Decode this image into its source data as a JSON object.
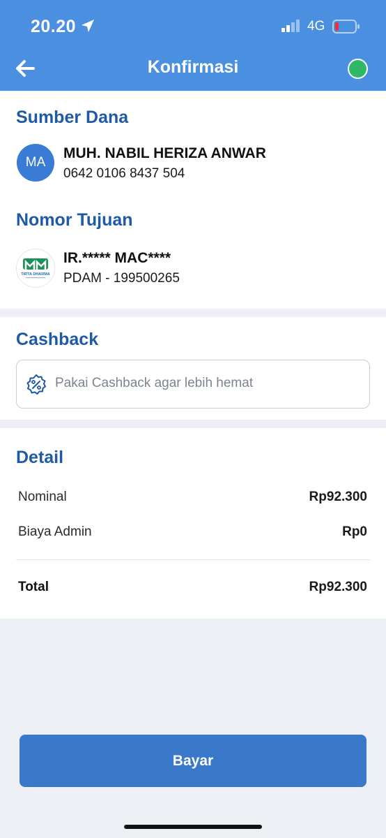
{
  "status_bar": {
    "time": "20.20",
    "network": "4G",
    "icons": [
      "location-arrow-icon",
      "signal-icon",
      "battery-icon"
    ]
  },
  "header": {
    "title": "Konfirmasi",
    "back_icon": "arrow-left-icon",
    "indicator_color": "#2fb866"
  },
  "source_section": {
    "title": "Sumber Dana",
    "avatar_initials": "MA",
    "account_name": "MUH. NABIL HERIZA ANWAR",
    "account_number": "0642 0106 8437 504"
  },
  "destination_section": {
    "title": "Nomor Tujuan",
    "logo_icon": "tirta-dharma-logo-icon",
    "logo_text": "TIRTA DHARMA",
    "name": "IR.***** MAC****",
    "sub": "PDAM - 199500265"
  },
  "cashback_section": {
    "title": "Cashback",
    "icon": "percent-badge-icon",
    "placeholder": "Pakai Cashback agar lebih hemat"
  },
  "detail_section": {
    "title": "Detail",
    "rows": [
      {
        "label": "Nominal",
        "value": "Rp92.300"
      },
      {
        "label": "Biaya Admin",
        "value": "Rp0"
      }
    ],
    "total_label": "Total",
    "total_value": "Rp92.300"
  },
  "actions": {
    "pay_label": "Bayar"
  },
  "colors": {
    "header_bg": "#4a8fe0",
    "section_title": "#1f5aa6",
    "primary_button": "#3a78c9",
    "page_bg": "#eceff4"
  }
}
